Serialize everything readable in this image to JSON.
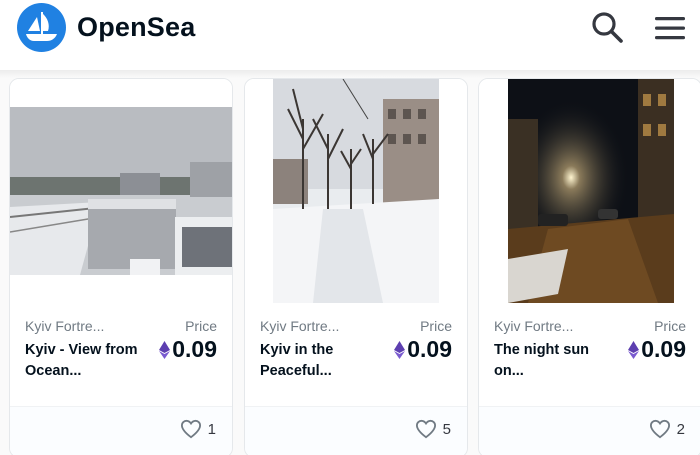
{
  "header": {
    "brand": "OpenSea",
    "logo_icon": "opensea-sailboat-logo",
    "search_icon": "search-icon",
    "menu_icon": "hamburger-menu-icon",
    "accent_color": "#2081e2"
  },
  "cards": [
    {
      "collection": "Kyiv Fortre...",
      "name": "Kyiv - View from Ocean...",
      "price_label": "Price",
      "price": "0.09",
      "currency_icon": "ethereum-icon",
      "likes": "1",
      "image_description_icon": "photo-thumbnail"
    },
    {
      "collection": "Kyiv Fortre...",
      "name": "Kyiv in the Peaceful...",
      "price_label": "Price",
      "price": "0.09",
      "currency_icon": "ethereum-icon",
      "likes": "5",
      "image_description_icon": "photo-thumbnail"
    },
    {
      "collection": "Kyiv Fortre...",
      "name": "The night sun on...",
      "price_label": "Price",
      "price": "0.09",
      "currency_icon": "ethereum-icon",
      "likes": "2",
      "image_description_icon": "photo-thumbnail"
    }
  ]
}
